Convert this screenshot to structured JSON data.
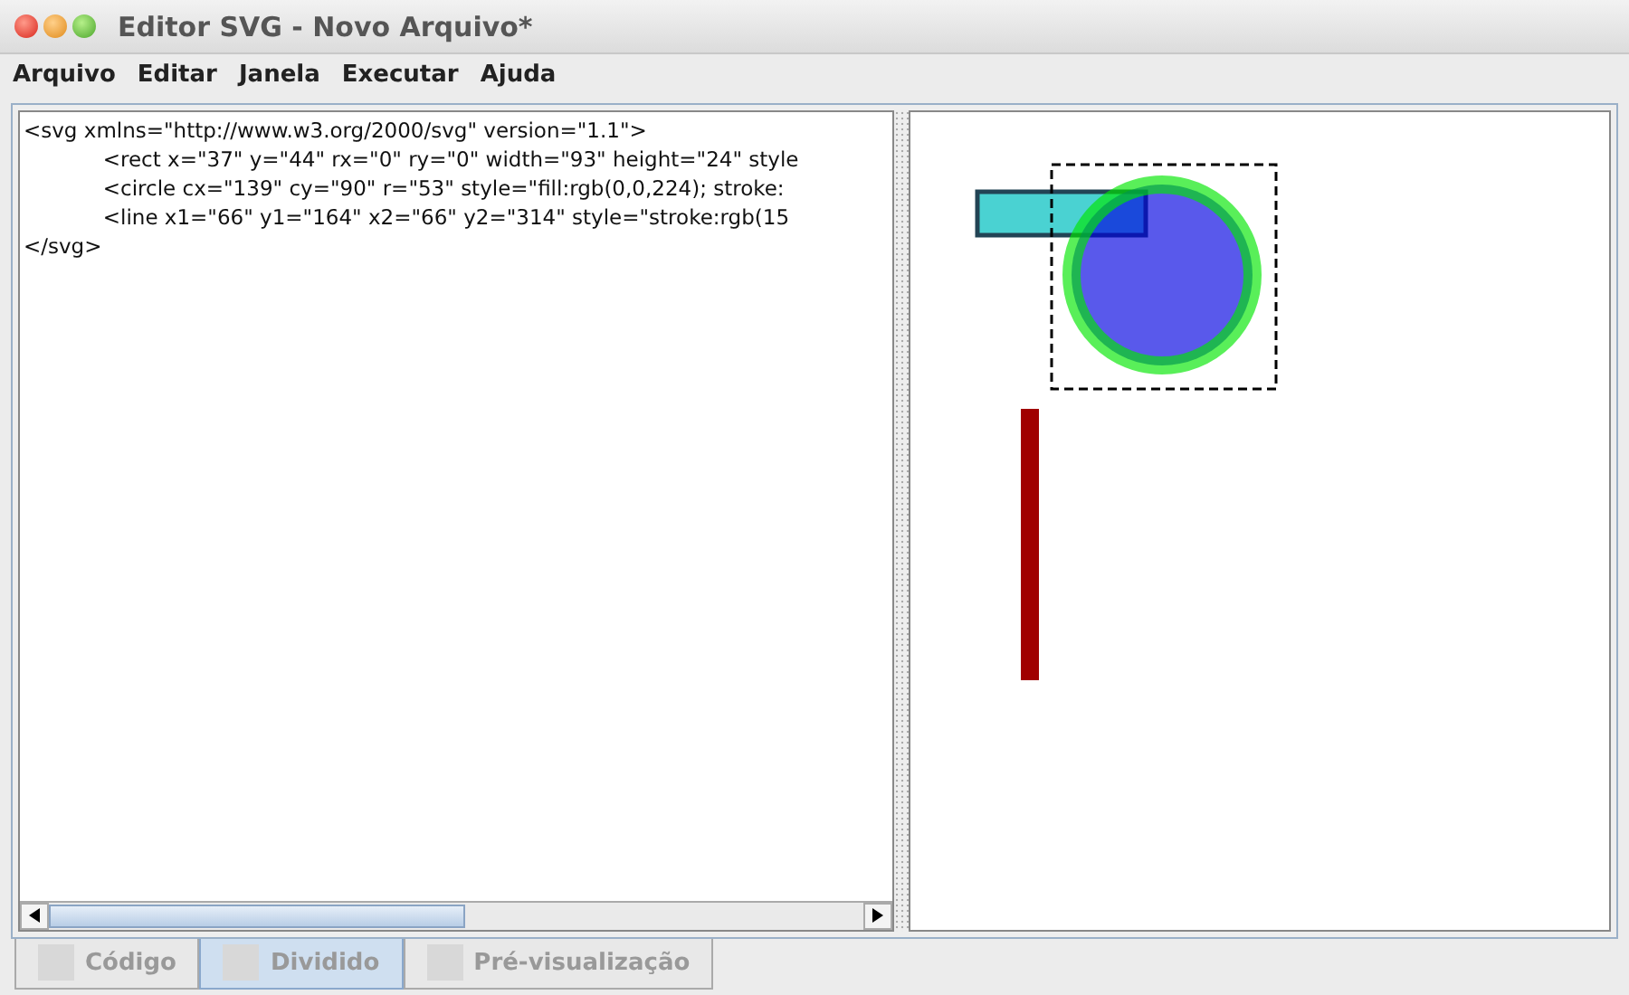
{
  "window": {
    "title": "Editor SVG - Novo Arquivo*"
  },
  "menu": [
    "Arquivo",
    "Editar",
    "Janela",
    "Executar",
    "Ajuda"
  ],
  "code_lines": [
    "<svg xmlns=\"http://www.w3.org/2000/svg\" version=\"1.1\">",
    "\t\t<rect x=\"37\" y=\"44\" rx=\"0\" ry=\"0\" width=\"93\" height=\"24\" style",
    "\t\t<circle cx=\"139\" cy=\"90\" r=\"53\" style=\"fill:rgb(0,0,224); stroke:",
    "\t\t<line x1=\"66\" y1=\"164\" x2=\"66\" y2=\"314\" style=\"stroke:rgb(15",
    "</svg>"
  ],
  "tabs": [
    {
      "label": "Código",
      "selected": false
    },
    {
      "label": "Dividido",
      "selected": true
    },
    {
      "label": "Pré-visualização",
      "selected": false
    }
  ]
}
